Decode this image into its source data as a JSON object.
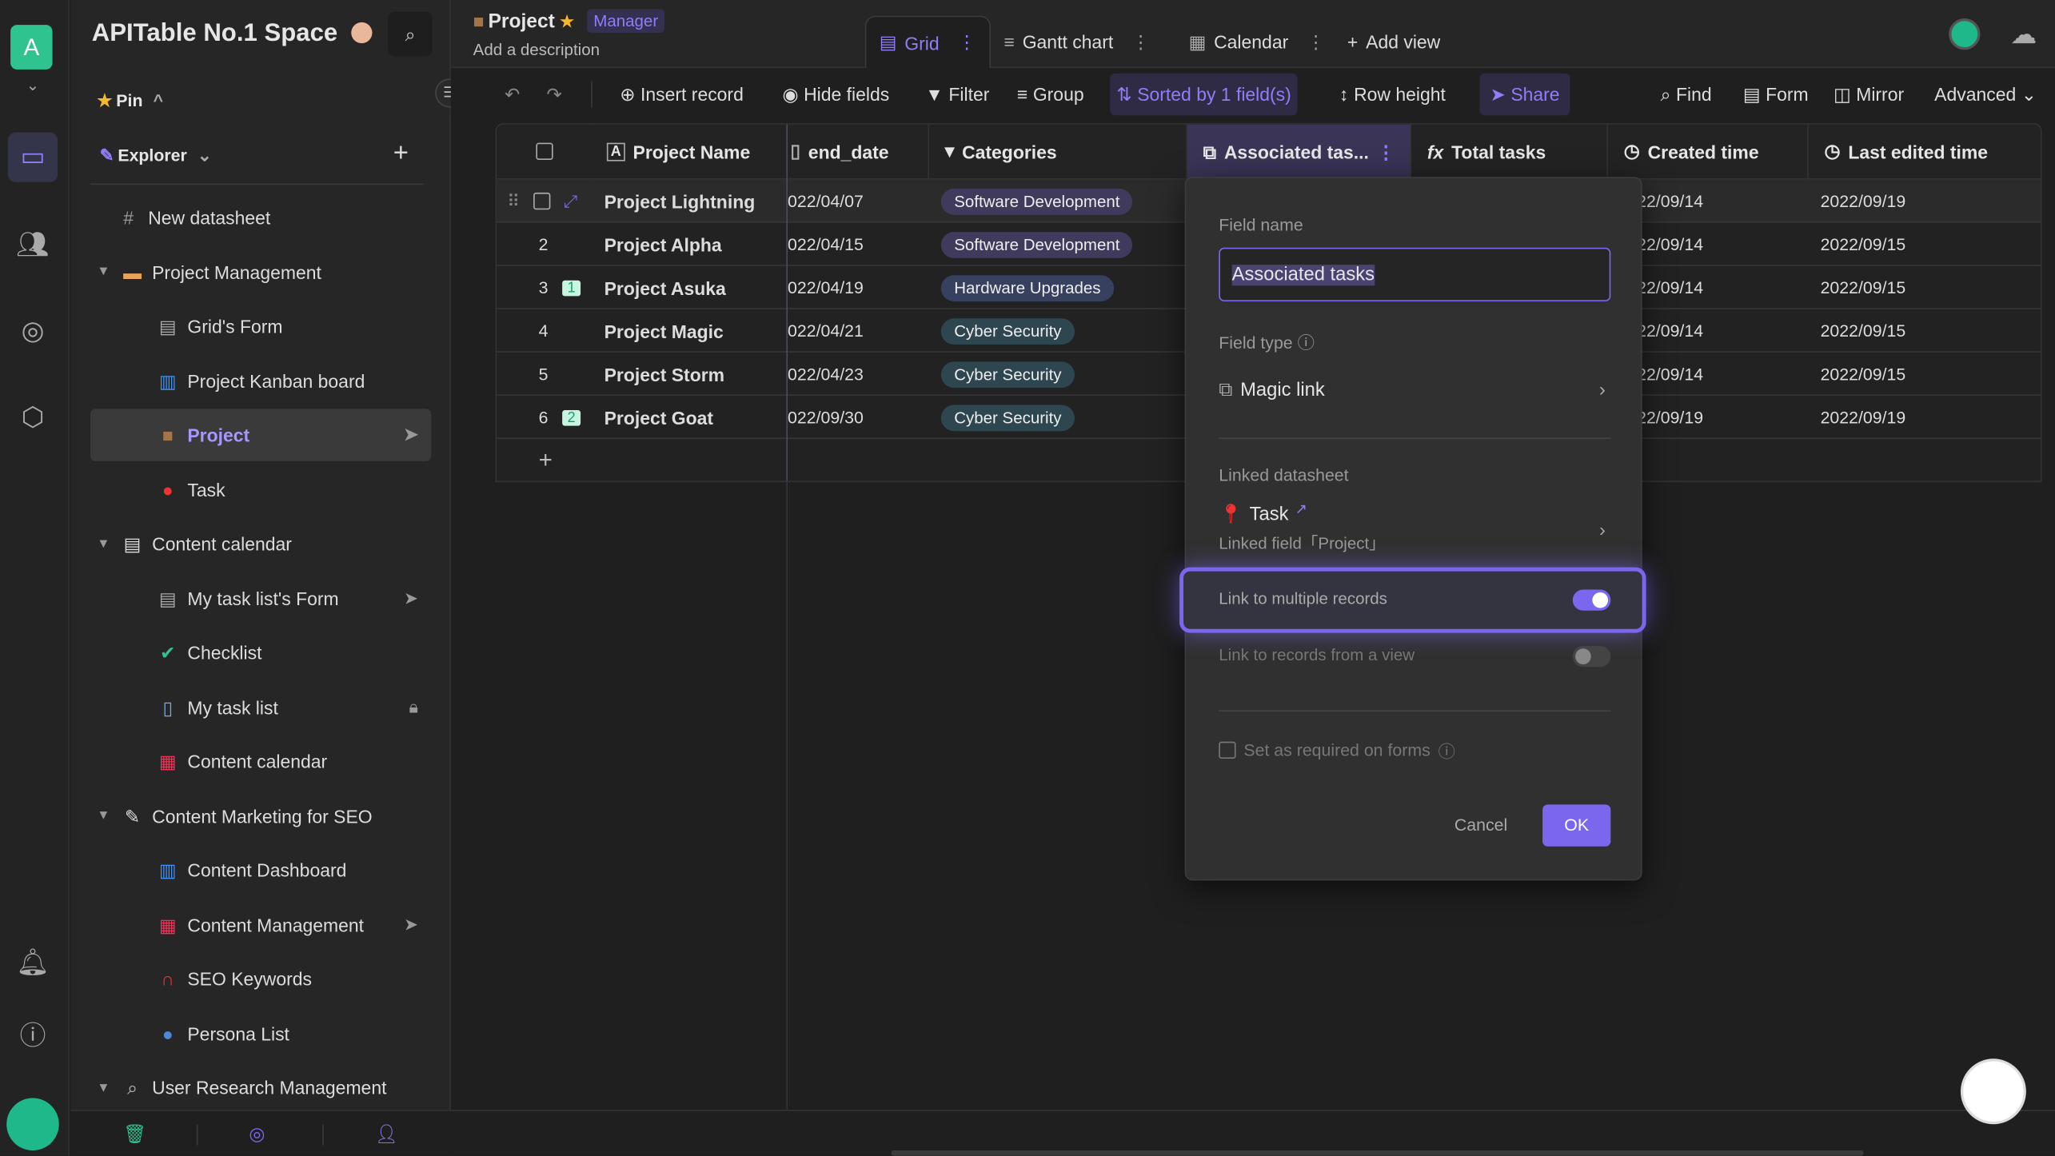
{
  "rail": {
    "space_initial": "A"
  },
  "sidebar": {
    "space_name": "APITable No.1 Space",
    "pin_label": "Pin",
    "explorer_label": "Explorer",
    "items": [
      {
        "label": "New datasheet",
        "icon": "hash-icon",
        "level": 1
      },
      {
        "label": "Project Management",
        "icon": "folder-icon",
        "level": 0,
        "expanded": true
      },
      {
        "label": "Grid's Form",
        "icon": "form-icon",
        "level": 2
      },
      {
        "label": "Project Kanban board",
        "icon": "chart-icon",
        "level": 2
      },
      {
        "label": "Project",
        "icon": "briefcase-icon",
        "level": 2,
        "selected": true,
        "share": true
      },
      {
        "label": "Task",
        "icon": "pin-icon",
        "level": 2
      },
      {
        "label": "Content calendar",
        "icon": "notepad-icon",
        "level": 0,
        "expanded": true
      },
      {
        "label": "My task list's Form",
        "icon": "form-icon",
        "level": 2,
        "share": true
      },
      {
        "label": "Checklist",
        "icon": "check-icon",
        "level": 2
      },
      {
        "label": "My task list",
        "icon": "book-icon",
        "level": 2,
        "locked": true
      },
      {
        "label": "Content calendar",
        "icon": "calendar-icon",
        "level": 2
      },
      {
        "label": "Content Marketing for SEO",
        "icon": "memo-icon",
        "level": 0,
        "expanded": true
      },
      {
        "label": "Content Dashboard",
        "icon": "chart-icon",
        "level": 2
      },
      {
        "label": "Content Management",
        "icon": "calendar-icon",
        "level": 2,
        "share": true
      },
      {
        "label": "SEO Keywords",
        "icon": "magnet-icon",
        "level": 2
      },
      {
        "label": "Persona List",
        "icon": "person-icon",
        "level": 2
      },
      {
        "label": "User Research Management",
        "icon": "magnifier-icon",
        "level": 0,
        "expanded": true
      }
    ]
  },
  "header": {
    "title": "Project",
    "role_badge": "Manager",
    "description": "Add a description",
    "tabs": [
      {
        "label": "Grid",
        "active": true
      },
      {
        "label": "Gantt chart"
      },
      {
        "label": "Calendar"
      }
    ],
    "add_view": "Add view"
  },
  "toolbar": {
    "insert": "Insert record",
    "hide": "Hide fields",
    "filter": "Filter",
    "group": "Group",
    "sort": "Sorted by 1 field(s)",
    "row_height": "Row height",
    "share": "Share",
    "find": "Find",
    "form": "Form",
    "mirror": "Mirror",
    "advanced": "Advanced"
  },
  "grid": {
    "columns": [
      "Project Name",
      "end_date",
      "Categories",
      "Associated tas...",
      "Total tasks",
      "Created time",
      "Last edited time"
    ],
    "rows": [
      {
        "num": "1",
        "name": "Project Lightning",
        "end": "022/04/07",
        "cat": "Software Development",
        "created": "22/09/14",
        "edited": "2022/09/19"
      },
      {
        "num": "2",
        "name": "Project Alpha",
        "end": "022/04/15",
        "cat": "Software Development",
        "created": "22/09/14",
        "edited": "2022/09/15"
      },
      {
        "num": "3",
        "comments": "1",
        "name": "Project Asuka",
        "end": "022/04/19",
        "cat": "Hardware Upgrades",
        "created": "22/09/14",
        "edited": "2022/09/15"
      },
      {
        "num": "4",
        "name": "Project Magic",
        "end": "022/04/21",
        "cat": "Cyber Security",
        "created": "22/09/14",
        "edited": "2022/09/15"
      },
      {
        "num": "5",
        "name": "Project Storm",
        "end": "022/04/23",
        "cat": "Cyber Security",
        "created": "22/09/14",
        "edited": "2022/09/15"
      },
      {
        "num": "6",
        "comments": "2",
        "name": "Project Goat",
        "end": "022/09/30",
        "cat": "Cyber Security",
        "created": "22/09/19",
        "edited": "2022/09/19"
      }
    ],
    "tag_colors": {
      "Software Development": "#403a5c",
      "Hardware Upgrades": "#37405e",
      "Cyber Security": "#2e4650"
    }
  },
  "field_popup": {
    "field_name_label": "Field name",
    "field_name_value": "Associated tasks",
    "field_type_label": "Field type",
    "field_type_value": "Magic link",
    "linked_label": "Linked datasheet",
    "linked_sheet": "Task",
    "linked_field": "Linked field「Project」",
    "multi_label": "Link to multiple records",
    "multi_on": true,
    "view_label": "Link to records from a view",
    "view_on": false,
    "required_label": "Set as required on forms",
    "required_checked": false,
    "cancel": "Cancel",
    "ok": "OK"
  },
  "colors": {
    "accent": "#7b67ee",
    "rail_badge": "#2fc48f"
  }
}
